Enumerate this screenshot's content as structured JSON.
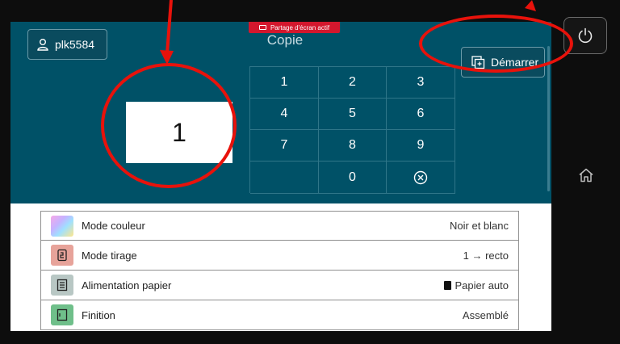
{
  "header": {
    "user_label": "plk5584",
    "screen_share_badge": "Partage d'écran actif",
    "title": "Copie",
    "start_label": "Démarrer"
  },
  "quantity": {
    "value": "1"
  },
  "keypad": {
    "keys": [
      "1",
      "2",
      "3",
      "4",
      "5",
      "6",
      "7",
      "8",
      "9",
      "0"
    ]
  },
  "options": [
    {
      "label": "Mode couleur",
      "value": "Noir et blanc",
      "icon": "color-mode-icon"
    },
    {
      "label": "Mode tirage",
      "value": "1 → recto",
      "icon": "duplex-icon"
    },
    {
      "label": "Alimentation papier",
      "value": "Papier auto",
      "icon": "paper-tray-icon"
    },
    {
      "label": "Finition",
      "value": "Assemblé",
      "icon": "finishing-icon"
    }
  ],
  "colors": {
    "panel": "#005167",
    "badge": "#d3172d",
    "annotation": "#e8120b"
  }
}
